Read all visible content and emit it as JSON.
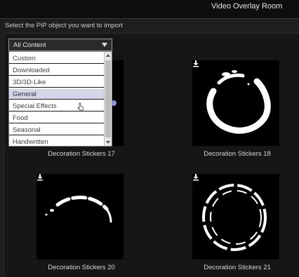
{
  "window": {
    "title": "Video Overlay Room"
  },
  "instructions": "Select the PiP object you want to import",
  "category_dropdown": {
    "selected": "All Content",
    "options": [
      "Custom",
      "Downloaded",
      "3D/3D-Like",
      "General",
      "Special Effects",
      "Food",
      "Seasonal",
      "Handwritten"
    ],
    "highlighted": "General"
  },
  "items": [
    {
      "label": "Decoration Stickers 17",
      "icon": "download-icon"
    },
    {
      "label": "Decoration Stickers 18",
      "icon": "download-icon"
    },
    {
      "label": "Decoration Stickers 20",
      "icon": "download-icon"
    },
    {
      "label": "Decoration Stickers 21",
      "icon": "download-icon"
    }
  ],
  "colors": {
    "background": "#1e1e1e",
    "titlebar": "#0e0e0e",
    "thumbnail": "#000000",
    "selection": "#d3d5e8"
  }
}
